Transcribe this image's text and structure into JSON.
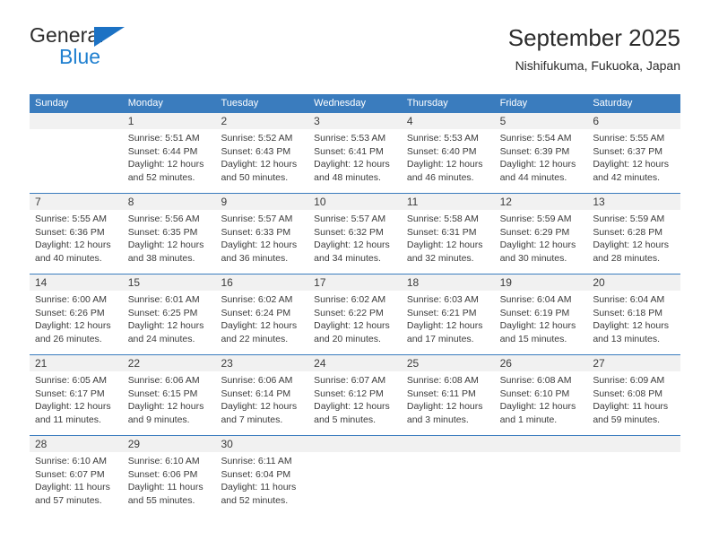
{
  "brand": {
    "line1": "General",
    "line2": "Blue",
    "triangle_color": "#1c72c4"
  },
  "header": {
    "title": "September 2025",
    "subtitle": "Nishifukuma, Fukuoka, Japan"
  },
  "theme": {
    "header_bg": "#3a7cbe",
    "daynum_bg": "#f1f1f1",
    "text": "#3b3b3b"
  },
  "weekdays": [
    "Sunday",
    "Monday",
    "Tuesday",
    "Wednesday",
    "Thursday",
    "Friday",
    "Saturday"
  ],
  "weeks": [
    {
      "days": [
        {
          "num": "",
          "lines": []
        },
        {
          "num": "1",
          "lines": [
            "Sunrise: 5:51 AM",
            "Sunset: 6:44 PM",
            "Daylight: 12 hours",
            "and 52 minutes."
          ]
        },
        {
          "num": "2",
          "lines": [
            "Sunrise: 5:52 AM",
            "Sunset: 6:43 PM",
            "Daylight: 12 hours",
            "and 50 minutes."
          ]
        },
        {
          "num": "3",
          "lines": [
            "Sunrise: 5:53 AM",
            "Sunset: 6:41 PM",
            "Daylight: 12 hours",
            "and 48 minutes."
          ]
        },
        {
          "num": "4",
          "lines": [
            "Sunrise: 5:53 AM",
            "Sunset: 6:40 PM",
            "Daylight: 12 hours",
            "and 46 minutes."
          ]
        },
        {
          "num": "5",
          "lines": [
            "Sunrise: 5:54 AM",
            "Sunset: 6:39 PM",
            "Daylight: 12 hours",
            "and 44 minutes."
          ]
        },
        {
          "num": "6",
          "lines": [
            "Sunrise: 5:55 AM",
            "Sunset: 6:37 PM",
            "Daylight: 12 hours",
            "and 42 minutes."
          ]
        }
      ]
    },
    {
      "days": [
        {
          "num": "7",
          "lines": [
            "Sunrise: 5:55 AM",
            "Sunset: 6:36 PM",
            "Daylight: 12 hours",
            "and 40 minutes."
          ]
        },
        {
          "num": "8",
          "lines": [
            "Sunrise: 5:56 AM",
            "Sunset: 6:35 PM",
            "Daylight: 12 hours",
            "and 38 minutes."
          ]
        },
        {
          "num": "9",
          "lines": [
            "Sunrise: 5:57 AM",
            "Sunset: 6:33 PM",
            "Daylight: 12 hours",
            "and 36 minutes."
          ]
        },
        {
          "num": "10",
          "lines": [
            "Sunrise: 5:57 AM",
            "Sunset: 6:32 PM",
            "Daylight: 12 hours",
            "and 34 minutes."
          ]
        },
        {
          "num": "11",
          "lines": [
            "Sunrise: 5:58 AM",
            "Sunset: 6:31 PM",
            "Daylight: 12 hours",
            "and 32 minutes."
          ]
        },
        {
          "num": "12",
          "lines": [
            "Sunrise: 5:59 AM",
            "Sunset: 6:29 PM",
            "Daylight: 12 hours",
            "and 30 minutes."
          ]
        },
        {
          "num": "13",
          "lines": [
            "Sunrise: 5:59 AM",
            "Sunset: 6:28 PM",
            "Daylight: 12 hours",
            "and 28 minutes."
          ]
        }
      ]
    },
    {
      "days": [
        {
          "num": "14",
          "lines": [
            "Sunrise: 6:00 AM",
            "Sunset: 6:26 PM",
            "Daylight: 12 hours",
            "and 26 minutes."
          ]
        },
        {
          "num": "15",
          "lines": [
            "Sunrise: 6:01 AM",
            "Sunset: 6:25 PM",
            "Daylight: 12 hours",
            "and 24 minutes."
          ]
        },
        {
          "num": "16",
          "lines": [
            "Sunrise: 6:02 AM",
            "Sunset: 6:24 PM",
            "Daylight: 12 hours",
            "and 22 minutes."
          ]
        },
        {
          "num": "17",
          "lines": [
            "Sunrise: 6:02 AM",
            "Sunset: 6:22 PM",
            "Daylight: 12 hours",
            "and 20 minutes."
          ]
        },
        {
          "num": "18",
          "lines": [
            "Sunrise: 6:03 AM",
            "Sunset: 6:21 PM",
            "Daylight: 12 hours",
            "and 17 minutes."
          ]
        },
        {
          "num": "19",
          "lines": [
            "Sunrise: 6:04 AM",
            "Sunset: 6:19 PM",
            "Daylight: 12 hours",
            "and 15 minutes."
          ]
        },
        {
          "num": "20",
          "lines": [
            "Sunrise: 6:04 AM",
            "Sunset: 6:18 PM",
            "Daylight: 12 hours",
            "and 13 minutes."
          ]
        }
      ]
    },
    {
      "days": [
        {
          "num": "21",
          "lines": [
            "Sunrise: 6:05 AM",
            "Sunset: 6:17 PM",
            "Daylight: 12 hours",
            "and 11 minutes."
          ]
        },
        {
          "num": "22",
          "lines": [
            "Sunrise: 6:06 AM",
            "Sunset: 6:15 PM",
            "Daylight: 12 hours",
            "and 9 minutes."
          ]
        },
        {
          "num": "23",
          "lines": [
            "Sunrise: 6:06 AM",
            "Sunset: 6:14 PM",
            "Daylight: 12 hours",
            "and 7 minutes."
          ]
        },
        {
          "num": "24",
          "lines": [
            "Sunrise: 6:07 AM",
            "Sunset: 6:12 PM",
            "Daylight: 12 hours",
            "and 5 minutes."
          ]
        },
        {
          "num": "25",
          "lines": [
            "Sunrise: 6:08 AM",
            "Sunset: 6:11 PM",
            "Daylight: 12 hours",
            "and 3 minutes."
          ]
        },
        {
          "num": "26",
          "lines": [
            "Sunrise: 6:08 AM",
            "Sunset: 6:10 PM",
            "Daylight: 12 hours",
            "and 1 minute."
          ]
        },
        {
          "num": "27",
          "lines": [
            "Sunrise: 6:09 AM",
            "Sunset: 6:08 PM",
            "Daylight: 11 hours",
            "and 59 minutes."
          ]
        }
      ]
    },
    {
      "days": [
        {
          "num": "28",
          "lines": [
            "Sunrise: 6:10 AM",
            "Sunset: 6:07 PM",
            "Daylight: 11 hours",
            "and 57 minutes."
          ]
        },
        {
          "num": "29",
          "lines": [
            "Sunrise: 6:10 AM",
            "Sunset: 6:06 PM",
            "Daylight: 11 hours",
            "and 55 minutes."
          ]
        },
        {
          "num": "30",
          "lines": [
            "Sunrise: 6:11 AM",
            "Sunset: 6:04 PM",
            "Daylight: 11 hours",
            "and 52 minutes."
          ]
        },
        {
          "num": "",
          "lines": []
        },
        {
          "num": "",
          "lines": []
        },
        {
          "num": "",
          "lines": []
        },
        {
          "num": "",
          "lines": []
        }
      ]
    }
  ]
}
